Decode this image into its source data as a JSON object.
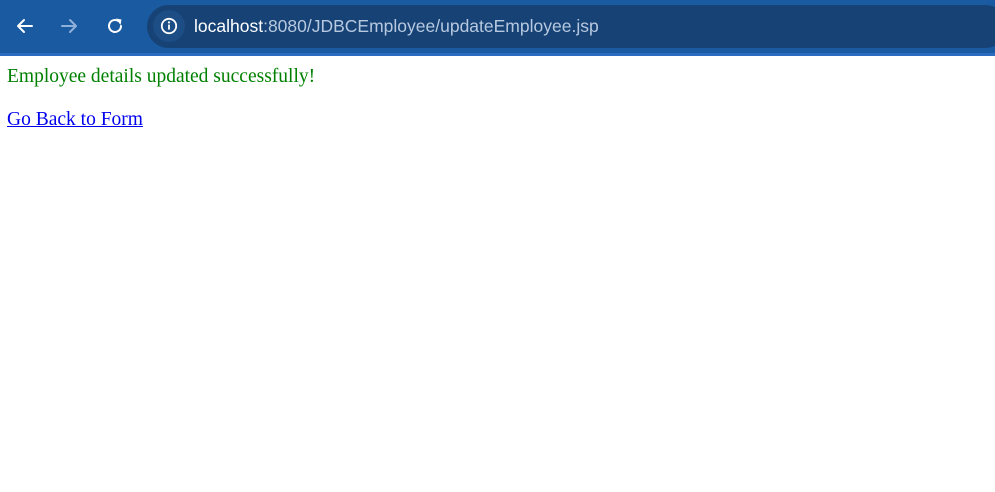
{
  "browser": {
    "back_icon": "arrow-left-icon",
    "forward_icon": "arrow-right-icon",
    "reload_icon": "reload-icon",
    "site_info_icon": "info-circle-icon",
    "url_host": "localhost",
    "url_path": ":8080/JDBCEmployee/updateEmployee.jsp",
    "toolbar_color": "#1a5aa0"
  },
  "page": {
    "message": "Employee details updated successfully!",
    "message_color": "#008000",
    "back_link_label": "Go Back to Form",
    "link_color": "#0000ee"
  }
}
